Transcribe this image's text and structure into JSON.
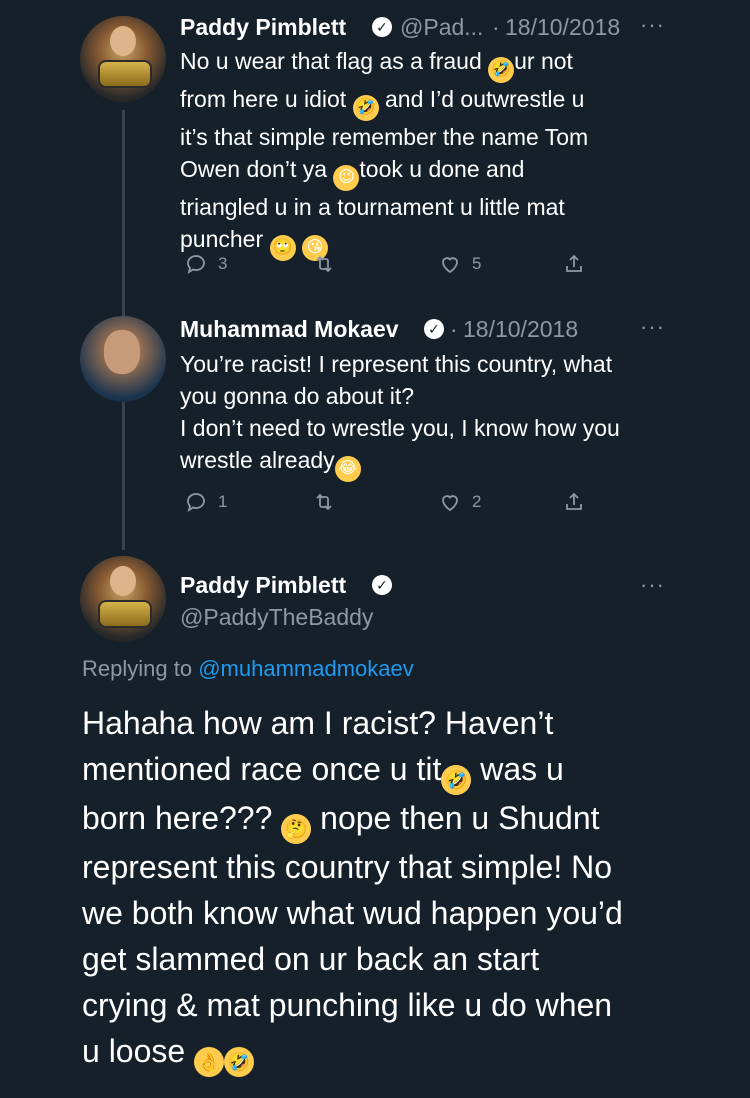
{
  "tweet1": {
    "name": "Paddy Pimblett",
    "handle": "@Pad...",
    "date": "18/10/2018",
    "lines": [
      "No u wear that flag as a fraud",
      "ur not",
      "from here u idiot",
      "and I’d outwrestle u",
      "it’s that simple remember the name Tom",
      "Owen don’t ya",
      "took u done and",
      "triangled u in a tournament u little mat",
      "puncher"
    ],
    "reply_count": "3",
    "retweet_count": "",
    "like_count": "5"
  },
  "tweet2": {
    "name": "Muhammad Mokaev",
    "date": "18/10/2018",
    "lines": [
      "You’re racist! I represent this country, what",
      "you gonna do about it?",
      "I don’t need to wrestle you, I know how you",
      "wrestle already"
    ],
    "reply_count": "1",
    "retweet_count": "",
    "like_count": "2"
  },
  "tweet3": {
    "name": "Paddy Pimblett",
    "handle": "@PaddyTheBaddy",
    "replying_label": "Replying to",
    "replying_handle": "@muhammadmokaev",
    "lines": [
      "Hahaha how am I racist? Haven’t",
      "mentioned race once u tit",
      "was u",
      "born here???",
      "nope then u Shudnt",
      "represent this country that simple! No",
      "we both know what wud happen you’d",
      "get slammed on ur back an start",
      "crying & mat punching like u do when",
      "u loose"
    ]
  },
  "colors": {
    "background": "#15202b",
    "text": "#ffffff",
    "muted": "#8b98a5",
    "link": "#1d9bf0",
    "thread_line": "#38444d"
  },
  "icons": [
    "reply-icon",
    "retweet-icon",
    "like-icon",
    "share-icon",
    "verified-icon",
    "more-icon"
  ]
}
